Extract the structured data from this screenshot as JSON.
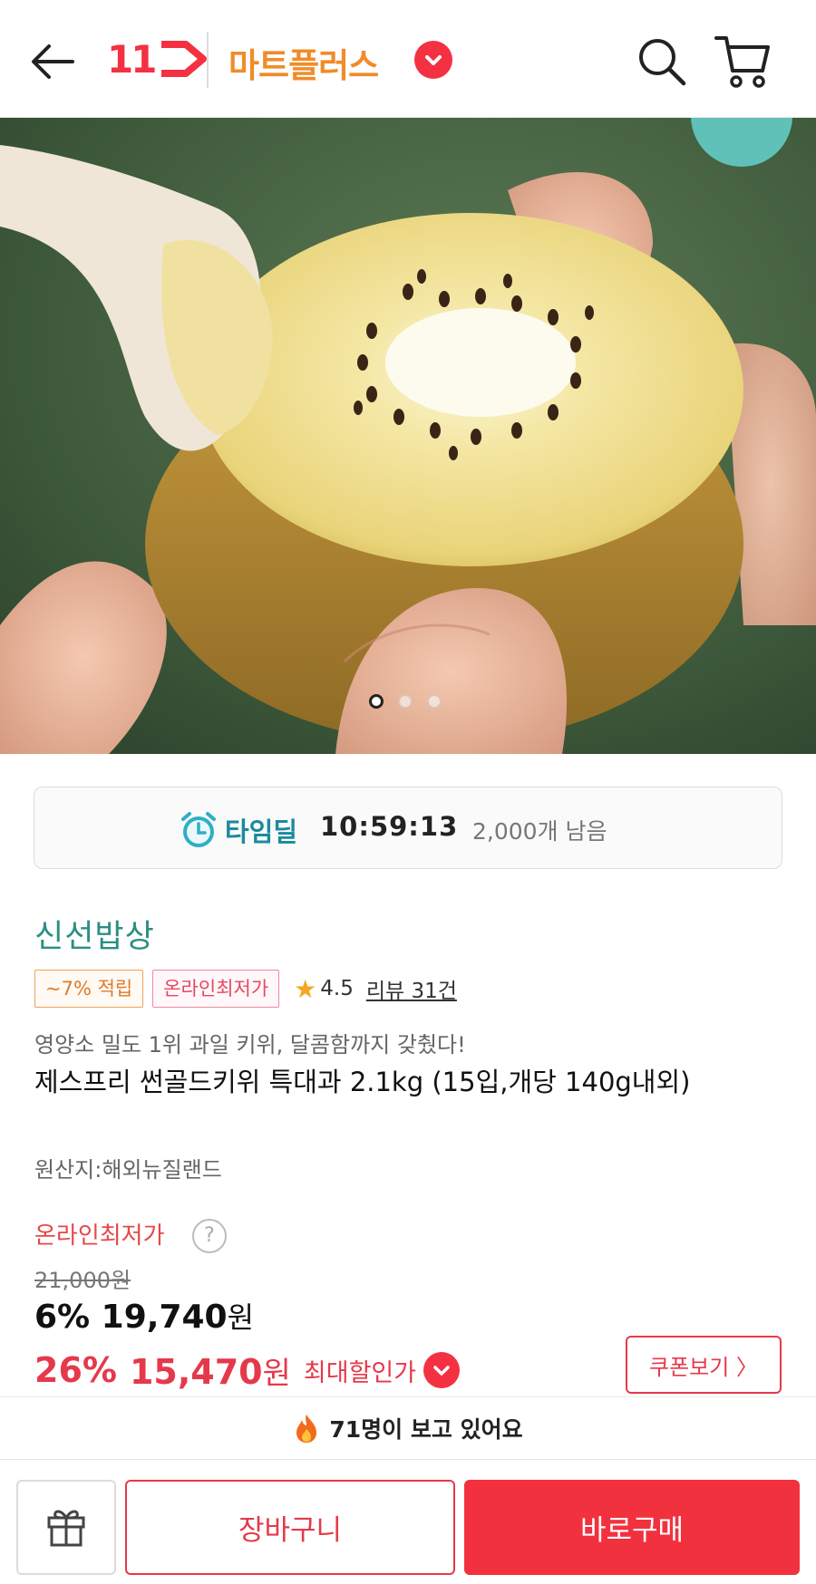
{
  "header": {
    "back_icon": "back-arrow-icon",
    "logo_text": "11",
    "mart_title": "마트플러스",
    "search_icon": "search-icon",
    "cart_icon": "cart-icon"
  },
  "hero": {
    "image_alt": "",
    "carousel_total": 3,
    "carousel_active": 1
  },
  "timedeal": {
    "icon": "alarm-clock-icon",
    "label": "타임딜",
    "time": "10:59:13",
    "remaining": "2,000개 남음"
  },
  "product": {
    "brand": "신선밥상",
    "badges": {
      "point": "~7% 적립",
      "lowest": "온라인최저가"
    },
    "rating": "4.5",
    "reviews": "리뷰 31건",
    "subtitle": "영양소 밀도 1위 과일 키위, 달콤함까지 갖췄다!",
    "title": "제스프리 썬골드키위 특대과 2.1kg (15입,개당 140g내외)",
    "origin": "원산지:해외뉴질랜드"
  },
  "price": {
    "label": "온라인최저가",
    "help": "?",
    "original": "21,000원",
    "sale_pct": "6%",
    "sale_price": "19,740",
    "sale_unit": "원",
    "max_pct": "26%",
    "max_price": "15,470",
    "max_unit": "원",
    "max_label": "최대할인가",
    "coupon_button": "쿠폰보기 〉"
  },
  "viewers": {
    "text": "71명이 보고 있어요"
  },
  "bottombar": {
    "gift_icon": "gift-icon",
    "cart_button": "장바구니",
    "buy_button": "바로구매"
  },
  "colors": {
    "brand_red": "#f43142",
    "mart_orange": "#f08c2a",
    "timedeal_teal": "#1b8a9e",
    "brand_green": "#2b8f82"
  }
}
